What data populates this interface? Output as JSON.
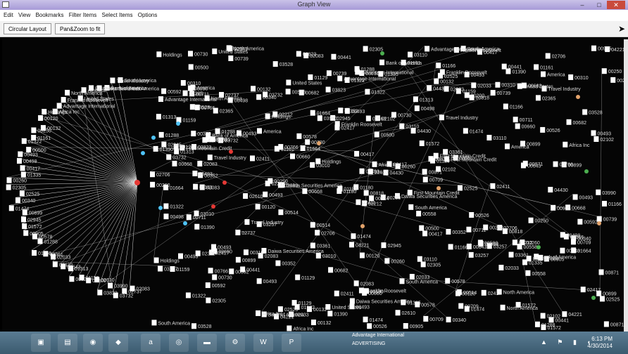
{
  "window": {
    "title": "Graph View"
  },
  "menu": [
    "Edit",
    "View",
    "Bookmarks",
    "Filter Items",
    "Select Items",
    "Options"
  ],
  "toolbar": {
    "circular_label": "Circular Layout",
    "panzoom_label": "Pan&Zoom to fit"
  },
  "colors": {
    "edge": "#d9d9d9",
    "node_red": "#e53935",
    "node_cyan": "#4fc3f7",
    "node_orange": "#e3a36b",
    "node_green": "#4caf50"
  },
  "graph": {
    "labels": [
      "South America",
      "Travel Industry",
      "Bank of America",
      "Daiwa Securities America",
      "First Mountain Credit",
      "America",
      "United States",
      "North America",
      "Franklin Roosevelt",
      "Advantage International",
      "Africa Inc",
      "Holdings",
      "00120",
      "00132",
      "00250",
      "01161",
      "01322",
      "00500",
      "00493",
      "00498",
      "00417",
      "01335",
      "00260",
      "02305",
      "02525",
      "00340",
      "01474",
      "00899",
      "02945",
      "01572",
      "00905",
      "00578",
      "01288",
      "01166",
      "03361",
      "02033",
      "04430",
      "00643",
      "01313",
      "00526",
      "01159",
      "00200",
      "02610",
      "03823",
      "03990",
      "03732",
      "02737",
      "02083",
      "01129",
      "00818",
      "02365",
      "03010",
      "00668",
      "00711",
      "02102",
      "01180",
      "02083",
      "00493",
      "02212",
      "00310",
      "00352",
      "00441",
      "02417",
      "02706",
      "03110",
      "01664",
      "02411",
      "03257",
      "04221",
      "01390",
      "00871",
      "03528",
      "00660",
      "00709",
      "00766",
      "00682",
      "00592",
      "00558",
      "00514",
      "00493",
      "00739",
      "00730"
    ]
  },
  "taskbar": {
    "apps": [
      "explorer",
      "firefox",
      "sidebar-tool",
      "amazon",
      "chrome",
      "terminal",
      "settings",
      "word",
      "powerpoint"
    ],
    "window_text": [
      "Advantage International",
      "ADVERTISING"
    ],
    "time": "6:13 PM",
    "date": "4/30/2014"
  }
}
